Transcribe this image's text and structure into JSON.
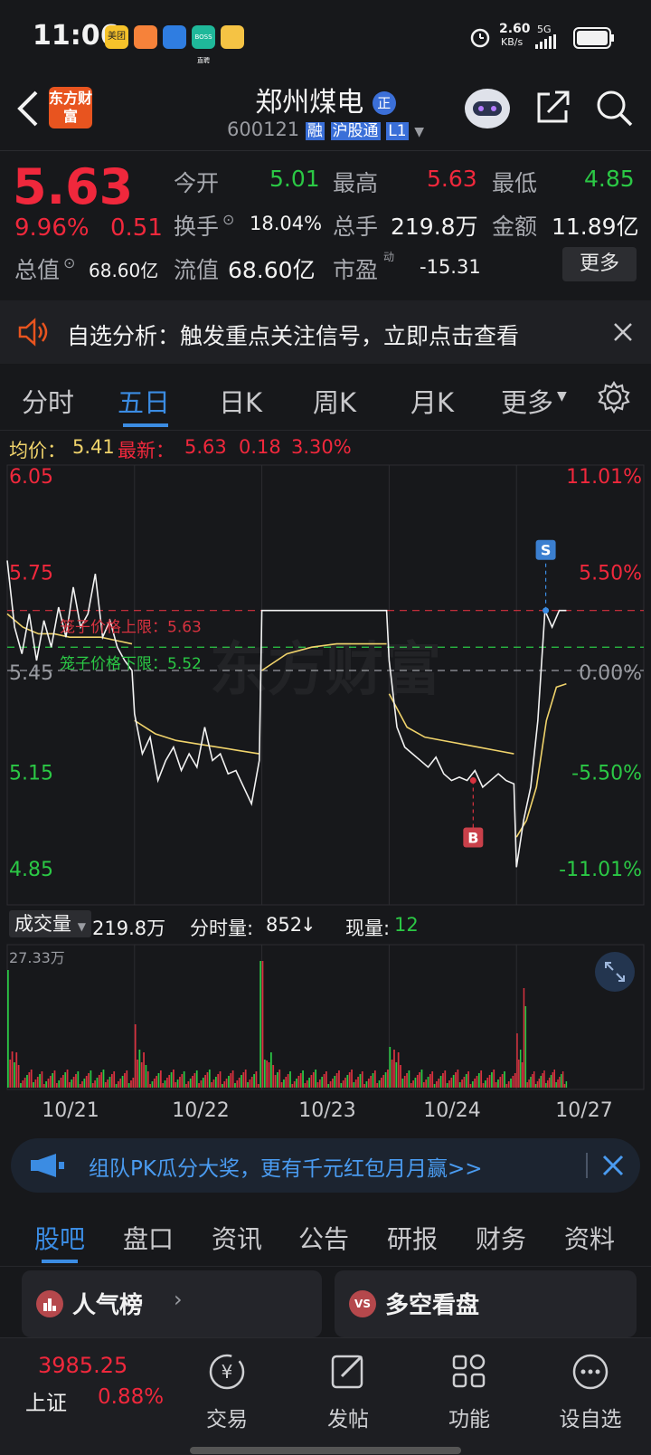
{
  "status_bar": {
    "time": "11:06",
    "apps": [
      "美团",
      "",
      "",
      "BOSS直聘",
      ""
    ],
    "net_speed": "2.60",
    "net_unit": "KB/s",
    "network": "5G"
  },
  "header": {
    "logo_text": "东方财富",
    "stock_name": "郑州煤电",
    "badge": "正",
    "code": "600121",
    "tags": [
      "融",
      "沪股通",
      "L1"
    ]
  },
  "quote": {
    "price": "5.63",
    "change_pct": "9.96%",
    "change": "0.51",
    "open_label": "今开",
    "open": "5.01",
    "high_label": "最高",
    "high": "5.63",
    "low_label": "最低",
    "low": "4.85",
    "turnover_label": "换手",
    "turnover": "18.04%",
    "volume_label": "总手",
    "volume": "219.8万",
    "amount_label": "金额",
    "amount": "11.89亿",
    "mcap_label": "总值",
    "mcap": "68.60亿",
    "float_label": "流值",
    "float": "68.60亿",
    "pe_label": "市盈",
    "pe_sup": "动",
    "pe": "-15.31",
    "more_label": "更多"
  },
  "alert": {
    "text": "自选分析：触发重点关注信号，立即点击查看"
  },
  "chart_tabs": [
    "分时",
    "五日",
    "日K",
    "周K",
    "月K",
    "更多"
  ],
  "active_chart_tab": 1,
  "avg_line": {
    "avg_label": "均价：",
    "avg_value": "5.41",
    "latest_label": "最新：",
    "latest_value": "5.63",
    "latest_change": "0.18",
    "latest_pct": "3.30%"
  },
  "chart_data": {
    "type": "line",
    "title": "",
    "y_left_ticks": [
      "6.05",
      "5.75",
      "5.45",
      "5.15",
      "4.85"
    ],
    "y_right_ticks": [
      "11.01%",
      "5.50%",
      "0.00%",
      "-5.50%",
      "-11.01%"
    ],
    "ylim": [
      4.85,
      6.05
    ],
    "x_labels": [
      "10/21",
      "10/22",
      "10/23",
      "10/24",
      "10/27"
    ],
    "upper_limit_label": "笼子价格上限：5.63",
    "lower_limit_label": "笼子价格下限：5.52",
    "upper_limit": 5.63,
    "lower_limit": 5.52,
    "prev_close": 5.45,
    "markers": [
      {
        "label": "B",
        "value": 5.12
      },
      {
        "label": "S",
        "value": 5.63
      }
    ],
    "watermark": "东方财富",
    "volume_max_label": "27.33万"
  },
  "volume_header": {
    "label": "成交量",
    "total": "219.8万",
    "minute_label": "分时量:",
    "minute_value": "852",
    "arrow": "↓",
    "current_label": "现量:",
    "current_value": "12"
  },
  "promo": {
    "text": "组队PK瓜分大奖，更有千元红包月月赢>>"
  },
  "bottom_tabs": [
    "股吧",
    "盘口",
    "资讯",
    "公告",
    "研报",
    "财务",
    "资料"
  ],
  "active_bottom_tab": 0,
  "cards": [
    {
      "title": "人气榜",
      "icon": "chart-icon"
    },
    {
      "title": "多空看盘",
      "icon": "vs-icon"
    }
  ],
  "bottom_nav": {
    "index_value": "3985.25",
    "index_name": "上证",
    "index_pct": "0.88%",
    "items": [
      "交易",
      "发帖",
      "功能",
      "设自选"
    ]
  },
  "colors": {
    "up": "#f0283c",
    "down": "#2bc845",
    "accent": "#3b8ce3",
    "avg": "#f0d36b",
    "brand": "#e8541f"
  }
}
